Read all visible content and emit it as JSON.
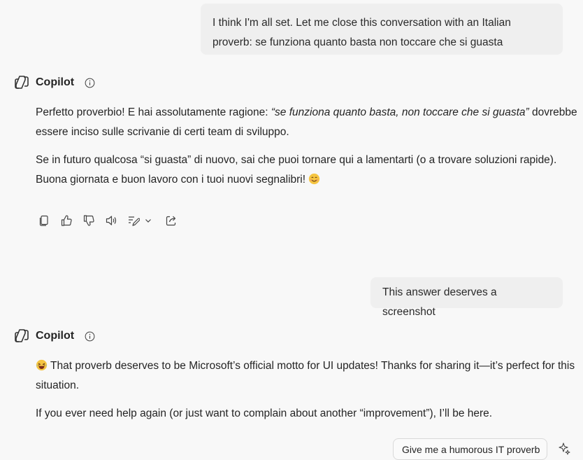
{
  "conversation": {
    "user_message_1": "I think I'm all set. Let me close this conversation with an Italian proverb: se funziona quanto basta non toccare che si guasta",
    "copilot_name": "Copilot",
    "reply_1": {
      "p1_before": "Perfetto proverbio! E hai assolutamente ragione: ",
      "p1_quote": "“se funziona quanto basta, non toccare che si guasta”",
      "p1_after": " dovrebbe essere inciso sulle scrivanie di certi team di sviluppo.",
      "p2": "Se in futuro qualcosa “si guasta” di nuovo, sai che puoi tornare qui a lamentarti (o a trovare soluzioni rapide). Buona giornata e buon lavoro con i tuoi nuovi segnalibri! "
    },
    "user_message_2": "This answer deserves a screenshot",
    "reply_2": {
      "p1": " That proverb deserves to be Microsoft’s official motto for UI updates! Thanks for sharing it—it’s perfect for this situation.",
      "p2": "If you ever need help again (or just want to complain about another “improvement”), I’ll be here."
    }
  },
  "action_bar": {
    "icons": [
      "copy-icon",
      "thumbs-up-icon",
      "thumbs-down-icon",
      "read-aloud-icon",
      "edit-icon",
      "chevron-down-icon",
      "share-icon"
    ]
  },
  "suggestion": {
    "label": "Give me a humorous IT proverb",
    "icon": "sparkle-icon"
  },
  "emojis": {
    "reply_1_end": "smiling-face-icon",
    "reply_2_start": "laughing-face-icon"
  },
  "colors": {
    "background": "#f8f8f8",
    "user_bubble": "#efefef",
    "text": "#242424"
  }
}
